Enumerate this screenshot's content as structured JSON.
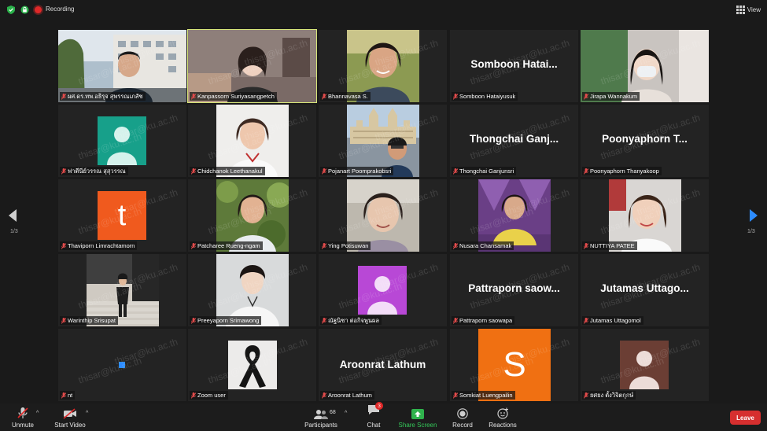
{
  "header": {
    "recording_label": "Recording",
    "view_label": "View"
  },
  "watermark_text": "thisar@ku.ac.th",
  "gallery": {
    "page_left": "1/3",
    "page_right": "1/3",
    "tiles": [
      {
        "name": "ผศ.ดร.ทพ.อธิรุจ สุพรรณเภสัช"
      },
      {
        "name": "Kanpassorn Suriyasangpetch"
      },
      {
        "name": "Bhannavasa S."
      },
      {
        "name": "Somboon Hataiyusuk",
        "display": "Somboon Hatai..."
      },
      {
        "name": "Jirapa Wannakum"
      },
      {
        "name": "ฟาตีนีย์วรรณ สุสุวรรณ"
      },
      {
        "name": "Chidchanok Leethanakul"
      },
      {
        "name": "Pojanart Poomprakobsri"
      },
      {
        "name": "Thongchai Ganjunsri",
        "display": "Thongchai Ganj..."
      },
      {
        "name": "Poonyaphorn Thanyakoop",
        "display": "Poonyaphorn T..."
      },
      {
        "name": "Thaviporn Limrachtamorn",
        "letter": "t"
      },
      {
        "name": "Patcharee Rueng-ngam"
      },
      {
        "name": "Ying Potisuwan"
      },
      {
        "name": "Nusara Chansamak"
      },
      {
        "name": "NUTTIYA PATEE"
      },
      {
        "name": "Warinthip Srisupat"
      },
      {
        "name": "Preeyaporn Srimawong"
      },
      {
        "name": "ณัฐนิชา ต่อกิจพูนผล"
      },
      {
        "name": "Pattraporn saowapa",
        "display": "Pattraporn saow..."
      },
      {
        "name": "Jutamas Uttagomol",
        "display": "Jutamas Uttago..."
      },
      {
        "name": "nt"
      },
      {
        "name": "Zoom user"
      },
      {
        "name": "Aroonrat Lathum",
        "display": "Aroonrat Lathum"
      },
      {
        "name": "Somkiat Luengpailin",
        "letter": "S"
      },
      {
        "name": "ยศยง ตั้งวิจิตกุกษ์"
      }
    ]
  },
  "toolbar": {
    "unmute": "Unmute",
    "start_video": "Start Video",
    "participants": "Participants",
    "participants_count": "68",
    "chat": "Chat",
    "chat_badge": "3",
    "share_screen": "Share Screen",
    "record": "Record",
    "reactions": "Reactions",
    "leave": "Leave"
  },
  "colors": {
    "accent_blue": "#2d8cff",
    "active_speaker": "#d7e67a",
    "leave_red": "#d62f2f",
    "share_green": "#34c759",
    "teal_avatar": "#17a08a",
    "orange_avatar": "#f05a1e",
    "violet_avatar": "#b848d6",
    "brown_avatar": "#6b3e34"
  }
}
